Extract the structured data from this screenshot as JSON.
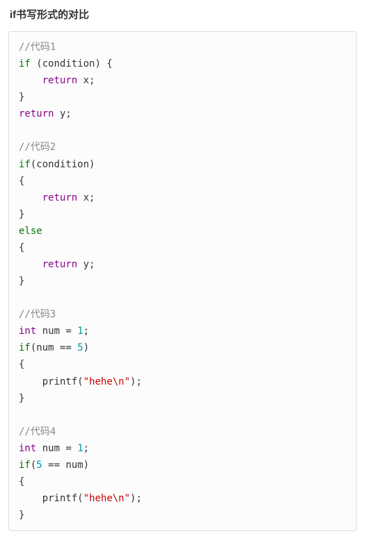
{
  "heading": "if书写形式的对比",
  "code": {
    "c1_comment": "//代码1",
    "c1_line1_kw": "if",
    "c1_line1_rest": " (condition) {",
    "c1_line2_ret": "return",
    "c1_line2_rest": " x;",
    "c1_line3": "}",
    "c1_line4_ret": "return",
    "c1_line4_rest": " y;",
    "c2_comment": "//代码2",
    "c2_line1_kw": "if",
    "c2_line1_rest": "(condition)",
    "c2_line2": "{",
    "c2_line3_ret": "return",
    "c2_line3_rest": " x;",
    "c2_line4": "}",
    "c2_line5_kw": "else",
    "c2_line6": "{",
    "c2_line7_ret": "return",
    "c2_line7_rest": " y;",
    "c2_line8": "}",
    "c3_comment": "//代码3",
    "c3_line1_ty": "int",
    "c3_line1_var": " num = ",
    "c3_line1_num": "1",
    "c3_line1_semi": ";",
    "c3_line2_kw": "if",
    "c3_line2_a": "(num == ",
    "c3_line2_num": "5",
    "c3_line2_b": ")",
    "c3_line3": "{",
    "c3_line4_fn": "printf",
    "c3_line4_a": "(",
    "c3_line4_str": "\"hehe\\n\"",
    "c3_line4_b": ");",
    "c3_line5": "}",
    "c4_comment": "//代码4",
    "c4_line1_ty": "int",
    "c4_line1_var": " num = ",
    "c4_line1_num": "1",
    "c4_line1_semi": ";",
    "c4_line2_kw": "if",
    "c4_line2_a": "(",
    "c4_line2_num": "5",
    "c4_line2_b": " == num)",
    "c4_line3": "{",
    "c4_line4_fn": "printf",
    "c4_line4_a": "(",
    "c4_line4_str": "\"hehe\\n\"",
    "c4_line4_b": ");",
    "c4_line5": "}"
  }
}
